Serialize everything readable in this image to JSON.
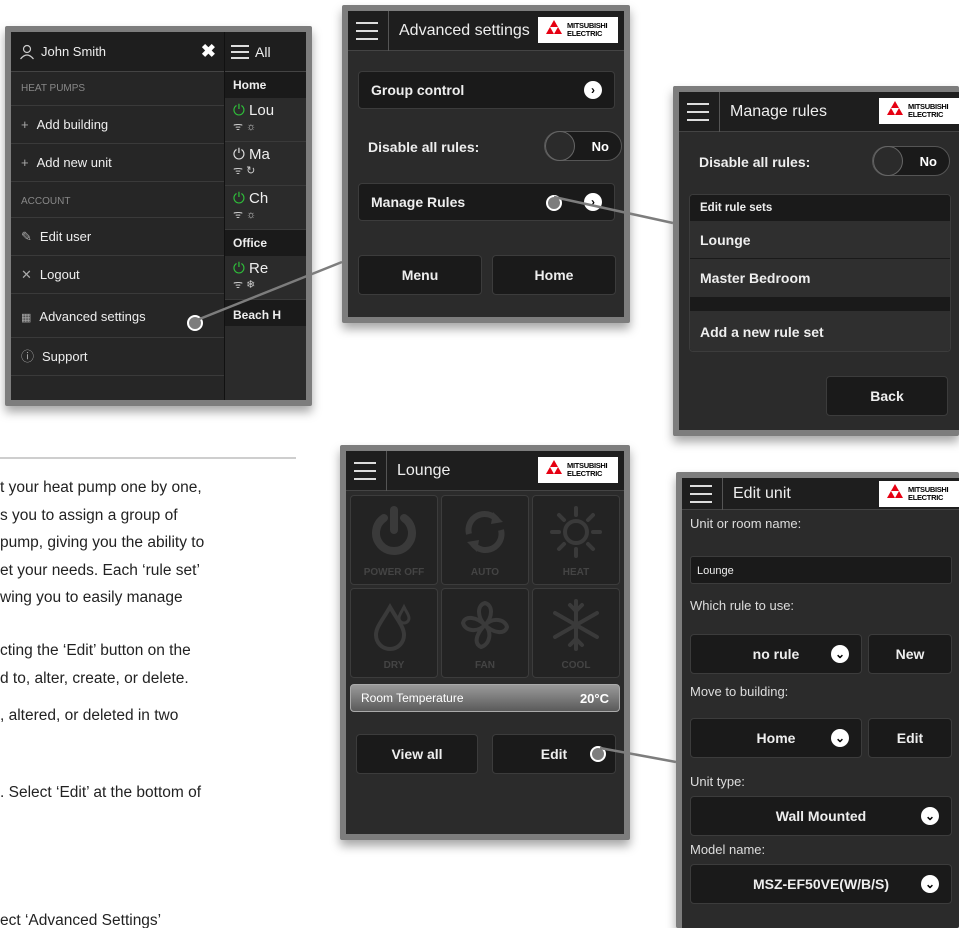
{
  "colors": {
    "frame": "#7d7d7d",
    "screen": "#2b2b2b",
    "topbar": "#1e1e1e",
    "power_green": "#2fbf3a",
    "logo_red": "#e60012"
  },
  "logo": {
    "line1": "MITSUBISHI",
    "line2": "ELECTRIC"
  },
  "menu": {
    "user_name": "John Smith",
    "section_heat_pumps": "HEAT PUMPS",
    "add_building": "Add building",
    "add_new_unit": "Add new unit",
    "section_account": "ACCOUNT",
    "edit_user": "Edit user",
    "logout": "Logout",
    "advanced_settings": "Advanced settings",
    "support": "Support",
    "behind_title": "All",
    "behind_home": "Home",
    "behind_office": "Office",
    "behind_beach": "Beach H",
    "behind_units": [
      "Lou",
      "Ma",
      "Ch",
      "Re"
    ]
  },
  "advanced": {
    "title": "Advanced settings",
    "group_control": "Group control",
    "disable_all_rules": "Disable all rules:",
    "toggle_value": "No",
    "manage_rules": "Manage Rules",
    "menu_button": "Menu",
    "home_button": "Home"
  },
  "manage": {
    "title": "Manage rules",
    "disable_all_rules": "Disable all rules:",
    "toggle_value": "No",
    "edit_rule_sets": "Edit rule sets",
    "rule_sets": [
      "Lounge",
      "Master Bedroom"
    ],
    "add_rule_set": "Add a new rule set",
    "back_button": "Back"
  },
  "lounge": {
    "title": "Lounge",
    "modes": [
      "POWER OFF",
      "AUTO",
      "HEAT",
      "DRY",
      "FAN",
      "COOL"
    ],
    "room_temp_label": "Room Temperature",
    "room_temp_value": "20°C",
    "view_all": "View all",
    "edit": "Edit"
  },
  "edit_unit": {
    "title": "Edit unit",
    "unit_name_label": "Unit or room name:",
    "unit_name_value": "Lounge",
    "rule_label": "Which rule to use:",
    "rule_value": "no rule",
    "new_button": "New",
    "building_label": "Move to building:",
    "building_value": "Home",
    "edit_button": "Edit",
    "unit_type_label": "Unit type:",
    "unit_type_value": "Wall Mounted",
    "model_label": "Model name:",
    "model_value": "MSZ-EF50VE(W/B/S)"
  },
  "body_text": {
    "line1": "t your heat pump one by one,",
    "line2": "s you to assign a group of",
    "line3": "pump, giving you the ability to",
    "line4": "et your needs. Each ‘rule set’",
    "line5": "wing you to easily manage",
    "line6": "cting the ‘Edit’ button on the",
    "line7": "d to, alter, create, or delete.",
    "line8": ", altered, or deleted in two",
    "line9": ". Select ‘Edit’ at the bottom of",
    "line10": "ect ‘Advanced Settings’"
  }
}
